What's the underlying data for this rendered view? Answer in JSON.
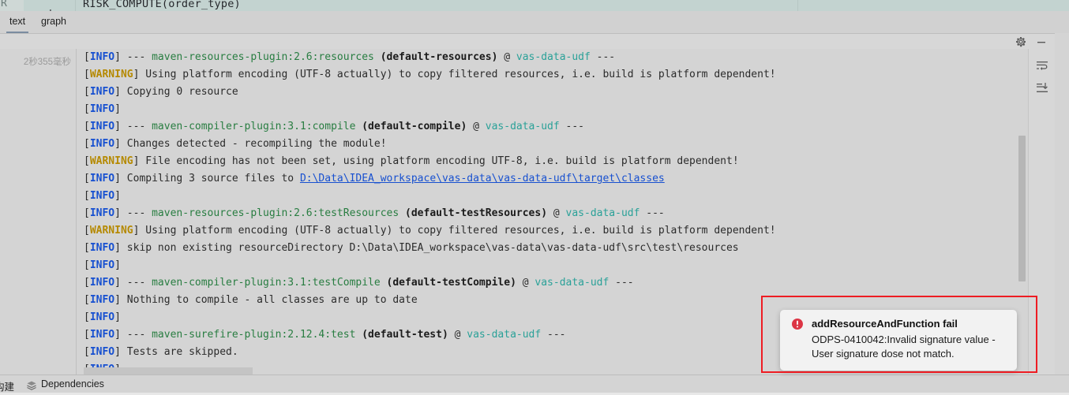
{
  "editor_strip": {
    "sql_fragment": "RISK_COMPUTE(order_type)",
    "row_marker": "R",
    "dot": "."
  },
  "tabs": [
    {
      "id": "text",
      "label": "text",
      "active": true
    },
    {
      "id": "graph",
      "label": "graph",
      "active": false
    }
  ],
  "console_header": {
    "settings_icon": "gear-icon",
    "minimize_icon": "minimize-icon"
  },
  "console": {
    "gutter_time": "2秒355毫秒",
    "lines": [
      {
        "tokens": [
          {
            "text": "[",
            "type": "bracket"
          },
          {
            "text": "INFO",
            "type": "info"
          },
          {
            "text": "] ",
            "type": "bracket"
          },
          {
            "text": "--- ",
            "type": "plain"
          },
          {
            "text": "maven-resources-plugin:2.6:resources ",
            "type": "plugin"
          },
          {
            "text": "(default-resources)",
            "type": "exec"
          },
          {
            "text": " @ ",
            "type": "plain"
          },
          {
            "text": "vas-data-udf",
            "type": "module"
          },
          {
            "text": " ---",
            "type": "plain"
          }
        ]
      },
      {
        "tokens": [
          {
            "text": "[",
            "type": "bracket"
          },
          {
            "text": "WARNING",
            "type": "warning"
          },
          {
            "text": "] ",
            "type": "bracket"
          },
          {
            "text": "Using platform encoding (UTF-8 actually) to copy filtered resources, i.e. build is platform dependent!",
            "type": "plain"
          }
        ]
      },
      {
        "tokens": [
          {
            "text": "[",
            "type": "bracket"
          },
          {
            "text": "INFO",
            "type": "info"
          },
          {
            "text": "] ",
            "type": "bracket"
          },
          {
            "text": "Copying 0 resource",
            "type": "plain"
          }
        ]
      },
      {
        "tokens": [
          {
            "text": "[",
            "type": "bracket"
          },
          {
            "text": "INFO",
            "type": "info"
          },
          {
            "text": "]",
            "type": "bracket"
          }
        ]
      },
      {
        "tokens": [
          {
            "text": "[",
            "type": "bracket"
          },
          {
            "text": "INFO",
            "type": "info"
          },
          {
            "text": "] ",
            "type": "bracket"
          },
          {
            "text": "--- ",
            "type": "plain"
          },
          {
            "text": "maven-compiler-plugin:3.1:compile ",
            "type": "plugin"
          },
          {
            "text": "(default-compile)",
            "type": "exec"
          },
          {
            "text": " @ ",
            "type": "plain"
          },
          {
            "text": "vas-data-udf",
            "type": "module"
          },
          {
            "text": " ---",
            "type": "plain"
          }
        ]
      },
      {
        "tokens": [
          {
            "text": "[",
            "type": "bracket"
          },
          {
            "text": "INFO",
            "type": "info"
          },
          {
            "text": "] ",
            "type": "bracket"
          },
          {
            "text": "Changes detected - recompiling the module!",
            "type": "plain"
          }
        ]
      },
      {
        "tokens": [
          {
            "text": "[",
            "type": "bracket"
          },
          {
            "text": "WARNING",
            "type": "warning"
          },
          {
            "text": "] ",
            "type": "bracket"
          },
          {
            "text": "File encoding has not been set, using platform encoding UTF-8, i.e. build is platform dependent!",
            "type": "plain"
          }
        ]
      },
      {
        "tokens": [
          {
            "text": "[",
            "type": "bracket"
          },
          {
            "text": "INFO",
            "type": "info"
          },
          {
            "text": "] ",
            "type": "bracket"
          },
          {
            "text": "Compiling 3 source files to ",
            "type": "plain"
          },
          {
            "text": "D:\\Data\\IDEA_workspace\\vas-data\\vas-data-udf\\target\\classes",
            "type": "link"
          }
        ]
      },
      {
        "tokens": [
          {
            "text": "[",
            "type": "bracket"
          },
          {
            "text": "INFO",
            "type": "info"
          },
          {
            "text": "]",
            "type": "bracket"
          }
        ]
      },
      {
        "tokens": [
          {
            "text": "[",
            "type": "bracket"
          },
          {
            "text": "INFO",
            "type": "info"
          },
          {
            "text": "] ",
            "type": "bracket"
          },
          {
            "text": "--- ",
            "type": "plain"
          },
          {
            "text": "maven-resources-plugin:2.6:testResources ",
            "type": "plugin"
          },
          {
            "text": "(default-testResources)",
            "type": "exec"
          },
          {
            "text": " @ ",
            "type": "plain"
          },
          {
            "text": "vas-data-udf",
            "type": "module"
          },
          {
            "text": " ---",
            "type": "plain"
          }
        ]
      },
      {
        "tokens": [
          {
            "text": "[",
            "type": "bracket"
          },
          {
            "text": "WARNING",
            "type": "warning"
          },
          {
            "text": "] ",
            "type": "bracket"
          },
          {
            "text": "Using platform encoding (UTF-8 actually) to copy filtered resources, i.e. build is platform dependent!",
            "type": "plain"
          }
        ]
      },
      {
        "tokens": [
          {
            "text": "[",
            "type": "bracket"
          },
          {
            "text": "INFO",
            "type": "info"
          },
          {
            "text": "] ",
            "type": "bracket"
          },
          {
            "text": "skip non existing resourceDirectory D:\\Data\\IDEA_workspace\\vas-data\\vas-data-udf\\src\\test\\resources",
            "type": "plain"
          }
        ]
      },
      {
        "tokens": [
          {
            "text": "[",
            "type": "bracket"
          },
          {
            "text": "INFO",
            "type": "info"
          },
          {
            "text": "]",
            "type": "bracket"
          }
        ]
      },
      {
        "tokens": [
          {
            "text": "[",
            "type": "bracket"
          },
          {
            "text": "INFO",
            "type": "info"
          },
          {
            "text": "] ",
            "type": "bracket"
          },
          {
            "text": "--- ",
            "type": "plain"
          },
          {
            "text": "maven-compiler-plugin:3.1:testCompile ",
            "type": "plugin"
          },
          {
            "text": "(default-testCompile)",
            "type": "exec"
          },
          {
            "text": " @ ",
            "type": "plain"
          },
          {
            "text": "vas-data-udf",
            "type": "module"
          },
          {
            "text": " ---",
            "type": "plain"
          }
        ]
      },
      {
        "tokens": [
          {
            "text": "[",
            "type": "bracket"
          },
          {
            "text": "INFO",
            "type": "info"
          },
          {
            "text": "] ",
            "type": "bracket"
          },
          {
            "text": "Nothing to compile - all classes are up to date",
            "type": "plain"
          }
        ]
      },
      {
        "tokens": [
          {
            "text": "[",
            "type": "bracket"
          },
          {
            "text": "INFO",
            "type": "info"
          },
          {
            "text": "]",
            "type": "bracket"
          }
        ]
      },
      {
        "tokens": [
          {
            "text": "[",
            "type": "bracket"
          },
          {
            "text": "INFO",
            "type": "info"
          },
          {
            "text": "] ",
            "type": "bracket"
          },
          {
            "text": "--- ",
            "type": "plain"
          },
          {
            "text": "maven-surefire-plugin:2.12.4:test ",
            "type": "plugin"
          },
          {
            "text": "(default-test)",
            "type": "exec"
          },
          {
            "text": " @ ",
            "type": "plain"
          },
          {
            "text": "vas-data-udf",
            "type": "module"
          },
          {
            "text": " ---",
            "type": "plain"
          }
        ]
      },
      {
        "tokens": [
          {
            "text": "[",
            "type": "bracket"
          },
          {
            "text": "INFO",
            "type": "info"
          },
          {
            "text": "] ",
            "type": "bracket"
          },
          {
            "text": "Tests are skipped.",
            "type": "plain"
          }
        ]
      },
      {
        "tokens": [
          {
            "text": "[",
            "type": "bracket"
          },
          {
            "text": "INFO",
            "type": "info"
          },
          {
            "text": "]",
            "type": "bracket"
          }
        ]
      }
    ]
  },
  "side_toolbar": {
    "soft_wrap_icon": "soft-wrap-icon",
    "scroll_to_end_icon": "scroll-to-end-icon"
  },
  "statusbar": {
    "build_label": "构建",
    "dependencies_label": "Dependencies",
    "dependencies_icon": "layers-icon"
  },
  "notification": {
    "title": "addResourceAndFunction fail",
    "message": "ODPS-0410042:Invalid signature value - User signature dose not match.",
    "icon": "error-icon",
    "icon_color": "#dc3545"
  },
  "annotation": {
    "border_color": "#ee1c23"
  }
}
